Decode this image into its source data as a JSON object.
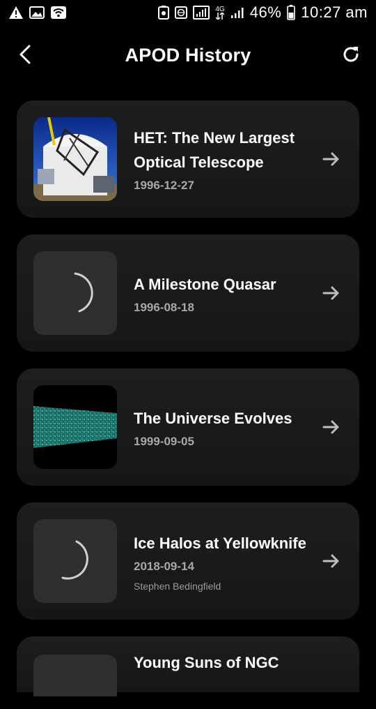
{
  "status_bar": {
    "battery_percent": "46%",
    "time": "10:27 am",
    "network": "4G"
  },
  "header": {
    "title": "APOD History"
  },
  "items": [
    {
      "title": "HET: The New Largest Optical Telescope",
      "date": "1996-12-27",
      "credit": ""
    },
    {
      "title": "A Milestone Quasar",
      "date": "1996-08-18",
      "credit": ""
    },
    {
      "title": "The Universe Evolves",
      "date": "1999-09-05",
      "credit": ""
    },
    {
      "title": "Ice Halos at Yellowknife",
      "date": "2018-09-14",
      "credit": "Stephen Bedingfield"
    },
    {
      "title": "Young Suns of NGC",
      "date": "",
      "credit": ""
    }
  ],
  "colors": {
    "background": "#000000",
    "card": "#1b1b1b",
    "placeholder": "#2f2f2f",
    "secondary_text": "#a8a8a8"
  }
}
